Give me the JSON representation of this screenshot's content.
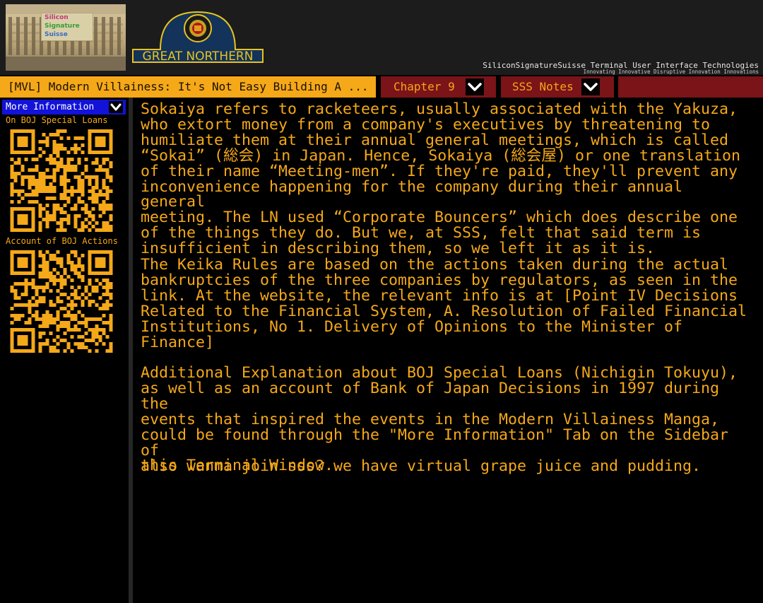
{
  "header": {
    "building_tag": [
      "Silicon",
      "Signature",
      "Suisse"
    ],
    "logo_text": "GREAT NORTHERN",
    "tagline": "SiliconSignatureSuisse Terminal User Interface Technologies",
    "subtagline": "Innovating Innovative Disruptive Innovation Innovations"
  },
  "tabs": {
    "title": "[MVL] Modern Villainess: It's Not Easy Building A ...",
    "chapter": "Chapter 9",
    "notes": "SSS Notes",
    "chevron_icon": "chevron-down-icon"
  },
  "sidebar": {
    "more_info": "More Information",
    "qr1_label": "On BOJ Special Loans",
    "qr2_label": "Account of BOJ Actions"
  },
  "colors": {
    "accent": "#f5a818",
    "tab_red": "#7a1418",
    "more_info_blue": "#1212d8",
    "background": "#000000"
  },
  "content": {
    "p1": "Sokaiya refers to racketeers, usually associated with the Yakuza,\nwho extort money from a company's executives by threatening to\nhumiliate them at their annual general meetings, which is called\n“Sokai” (総会) in Japan. Hence, Sokaiya (総会屋) or one translation\nof their name “Meeting-men”. If they're paid, they'll prevent any\ninconvenience happening for the company during their annual general\nmeeting. The LN used “Corporate Bouncers” which does describe one\nof the things they do. But we, at SSS, felt that said term is\ninsufficient in describing them, so we left it as it is.",
    "p2": "The Keika Rules are based on the actions taken during the actual\nbankruptcies of the three companies by regulators, as seen in the\nlink. At the website, the relevant info is at [Point IV Decisions\nRelated to the Financial System, A. Resolution of Failed Financial\nInstitutions, No 1. Delivery of Opinions to the Minister of\nFinance]",
    "p3": "Additional Explanation about BOJ Special Loans (Nichigin Tokuyu),\nas well as an account of Bank of Japan Decisions in 1997 during the\nevents that inspired the events in the Modern Villainess Manga,\ncould be found through the \"More Information\" Tab on the Sidebar of\nthis Terminal Window.",
    "p4": "also wanna join sss? we have virtual grape juice and pudding."
  }
}
